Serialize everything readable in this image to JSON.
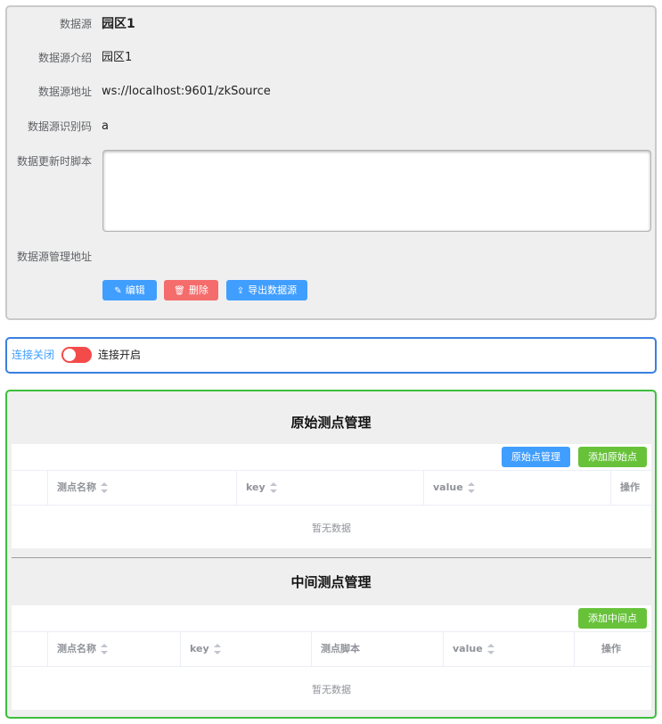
{
  "datasource": {
    "name_label": "数据源",
    "name_value": "园区1",
    "intro_label": "数据源介绍",
    "intro_value": "园区1",
    "address_label": "数据源地址",
    "address_value": "ws://localhost:9601/zkSource",
    "code_label": "数据源识别码",
    "code_value": "a",
    "script_label": "数据更新时脚本",
    "script_value": "",
    "manage_label": "数据源管理地址",
    "manage_value": "",
    "buttons": {
      "edit": "编辑",
      "delete": "删除",
      "export": "导出数据源"
    }
  },
  "connection": {
    "off_label": "连接关闭",
    "on_label": "连接开启",
    "state": "off"
  },
  "raw_points": {
    "title": "原始测点管理",
    "manage_button": "原始点管理",
    "add_button": "添加原始点",
    "columns": [
      "测点名称",
      "key",
      "value",
      "操作"
    ],
    "rows": [],
    "empty_text": "暂无数据"
  },
  "mid_points": {
    "title": "中间测点管理",
    "add_button": "添加中间点",
    "columns": [
      "测点名称",
      "key",
      "测点脚本",
      "value",
      "操作"
    ],
    "rows": [],
    "empty_text": "暂无数据"
  },
  "colors": {
    "primary": "#409eff",
    "danger": "#f56c6c",
    "success": "#67c23a",
    "switch_off": "#f54a4a"
  },
  "icons": {
    "edit": "pencil-icon",
    "delete": "trash-icon",
    "export": "upload-icon"
  }
}
